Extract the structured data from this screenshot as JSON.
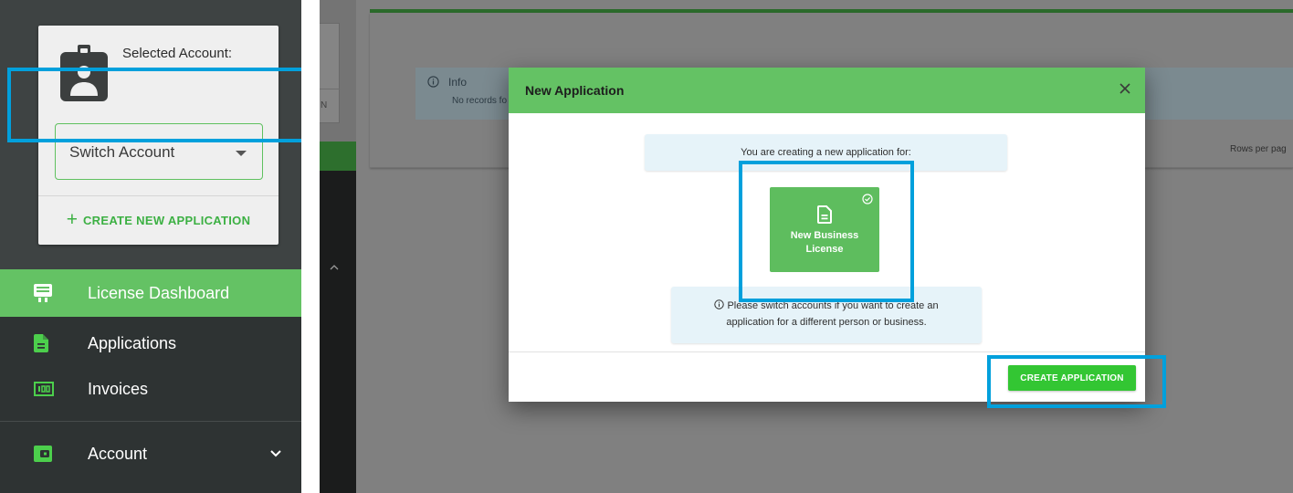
{
  "account_card": {
    "selected_account_label": "Selected Account:",
    "switch_account_placeholder": "Switch Account",
    "create_new_application_label": "CREATE NEW APPLICATION"
  },
  "sidebar": {
    "items": [
      {
        "label": "License Dashboard",
        "icon": "monitor-icon",
        "active": true
      },
      {
        "label": "Applications",
        "icon": "document-icon",
        "active": false
      },
      {
        "label": "Invoices",
        "icon": "invoice-icon",
        "active": false
      },
      {
        "label": "Account",
        "icon": "wallet-icon",
        "active": false,
        "expandable": true
      }
    ]
  },
  "background": {
    "info_title": "Info",
    "info_text": "No records fo",
    "rows_per_page_label": "Rows per pag",
    "side_letter": "N"
  },
  "modal": {
    "title": "New Application",
    "creating_for_text": "You are creating a new application for:",
    "tile": {
      "line1": "New Business",
      "line2": "License",
      "selected": true
    },
    "notice_line_1": "Please switch accounts if you want to create an",
    "notice_line_2": "application for a different person or business.",
    "create_button_label": "CREATE APPLICATION"
  },
  "colors": {
    "brand_green": "#64c264",
    "button_green": "#33c633",
    "link_green": "#3cb043",
    "sidebar_dark": "#2e3333",
    "highlight_blue": "#00a0dc",
    "info_bg": "#e6f3f9"
  }
}
